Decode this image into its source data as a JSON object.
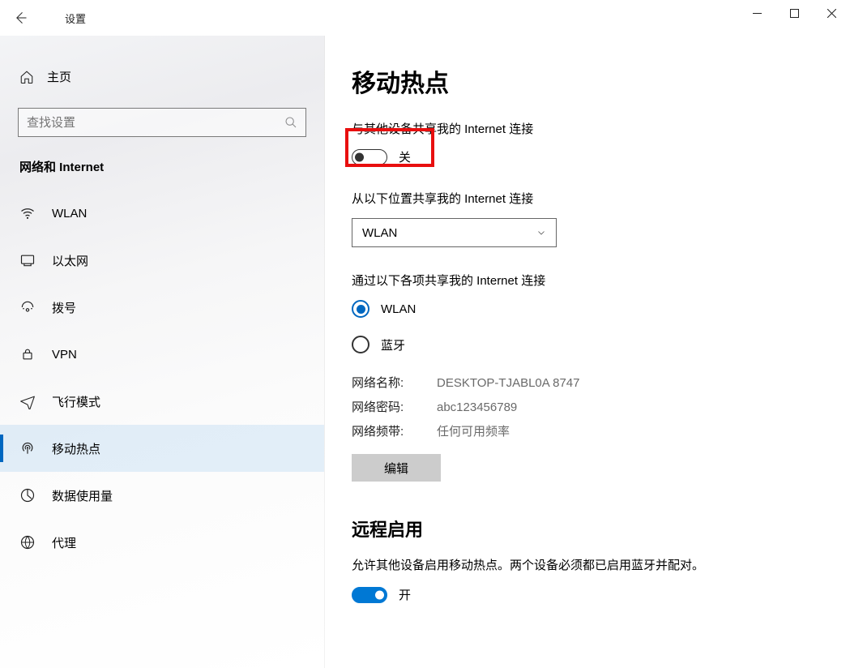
{
  "window": {
    "title": "设置"
  },
  "sidebar": {
    "home": "主页",
    "search_placeholder": "查找设置",
    "category": "网络和 Internet",
    "items": [
      {
        "label": "WLAN"
      },
      {
        "label": "以太网"
      },
      {
        "label": "拨号"
      },
      {
        "label": "VPN"
      },
      {
        "label": "飞行模式"
      },
      {
        "label": "移动热点"
      },
      {
        "label": "数据使用量"
      },
      {
        "label": "代理"
      }
    ]
  },
  "main": {
    "title": "移动热点",
    "share_label": "与其他设备共享我的 Internet 连接",
    "share_toggle_state": "关",
    "from_label": "从以下位置共享我的 Internet 连接",
    "from_value": "WLAN",
    "via_label": "通过以下各项共享我的 Internet 连接",
    "via_options": {
      "wlan": "WLAN",
      "bt": "蓝牙"
    },
    "info": {
      "name_k": "网络名称:",
      "name_v": "DESKTOP-TJABL0A 8747",
      "pwd_k": "网络密码:",
      "pwd_v": "abc123456789",
      "band_k": "网络频带:",
      "band_v": "任何可用频率"
    },
    "edit_btn": "编辑",
    "remote_heading": "远程启用",
    "remote_desc": "允许其他设备启用移动热点。两个设备必须都已启用蓝牙并配对。",
    "remote_toggle_state": "开"
  }
}
